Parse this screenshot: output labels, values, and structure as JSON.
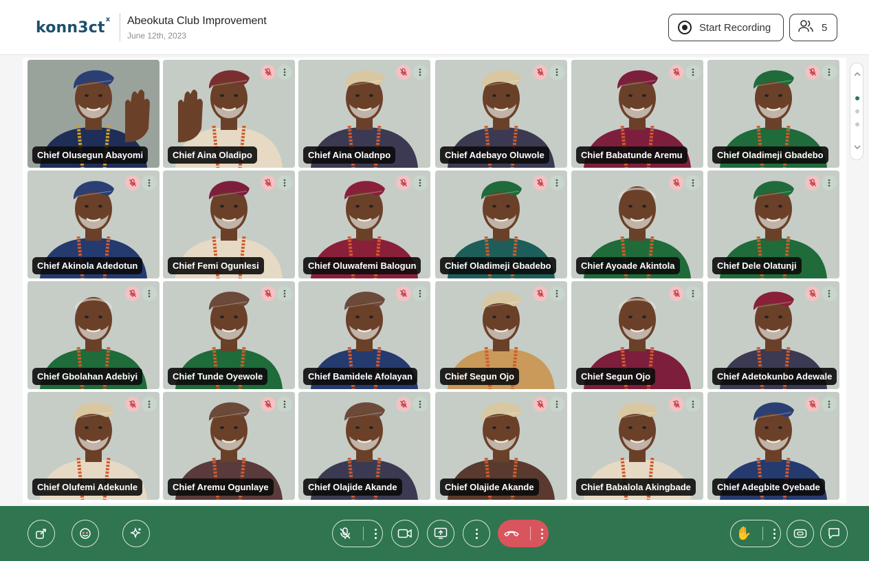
{
  "header": {
    "logo_text": "konn3ct",
    "logo_mark": "x",
    "meeting_title": "Abeokuta Club Improvement",
    "meeting_date": "June 12th, 2023",
    "record_button": "Start Recording",
    "participants_count": "5"
  },
  "participants": [
    {
      "name": "Chief Olusegun Abayomi",
      "cap": "#2b3f74",
      "robe": "#1f2e57",
      "trim": "#d4a017",
      "bg": "#9aa39b",
      "waving": true,
      "muted": false
    },
    {
      "name": "Chief Aina Oladipo",
      "cap": "#7b2e2e",
      "robe": "#e6dac4",
      "trim": "#d45a2a",
      "bg": "#c4ccc5",
      "waving": true,
      "muted": true
    },
    {
      "name": "Chief Aina Oladnpo",
      "cap": "#d8c7a0",
      "robe": "#3b3a52",
      "trim": "#d45a2a",
      "bg": "#c6cdc7",
      "waving": false,
      "muted": true
    },
    {
      "name": "Chief Adebayo Oluwole",
      "cap": "#d8c7a0",
      "robe": "#3b3a52",
      "trim": "#d45a2a",
      "bg": "#c6cdc7",
      "waving": false,
      "muted": true
    },
    {
      "name": "Chief Babatunde Aremu",
      "cap": "#7d1f3c",
      "robe": "#7d1f3c",
      "trim": "#d45a2a",
      "bg": "#c6cdc7",
      "waving": false,
      "muted": true
    },
    {
      "name": "Chief Oladimeji Gbadebo",
      "cap": "#1f6b3a",
      "robe": "#1f6b3a",
      "trim": "#d45a2a",
      "bg": "#c6cdc7",
      "waving": false,
      "muted": true
    },
    {
      "name": "Chief Akinola Adedotun",
      "cap": "#2b3f74",
      "robe": "#253a6e",
      "trim": "#d45a2a",
      "bg": "#c6cdc7",
      "waving": false,
      "muted": true
    },
    {
      "name": "Chief Femi Ogunlesi",
      "cap": "#7d1f3c",
      "robe": "#e6dac4",
      "trim": "#d45a2a",
      "bg": "#c6cdc7",
      "waving": false,
      "muted": true
    },
    {
      "name": "Chief Oluwafemi Balogun",
      "cap": "#8a1f3a",
      "robe": "#8a1f3a",
      "trim": "#d45a2a",
      "bg": "#c6cdc7",
      "waving": false,
      "muted": true
    },
    {
      "name": "Chief Oladimeji Gbadebo",
      "cap": "#1f6b3a",
      "robe": "#1d5e5a",
      "trim": "#d45a2a",
      "bg": "#c6cdc7",
      "waving": false,
      "muted": true
    },
    {
      "name": "Chief Ayoade Akintola",
      "cap": "none",
      "robe": "#1f6b3a",
      "trim": "#d45a2a",
      "bg": "#c6cdc7",
      "waving": false,
      "muted": true
    },
    {
      "name": "Chief Dele Olatunji",
      "cap": "#1f6b3a",
      "robe": "#1f6b3a",
      "trim": "#d45a2a",
      "bg": "#c6cdc7",
      "waving": false,
      "muted": true
    },
    {
      "name": "Chief Gbolahan Adebiyi",
      "cap": "none",
      "robe": "#1f6b3a",
      "trim": "#d45a2a",
      "bg": "#c6cdc7",
      "waving": false,
      "muted": true
    },
    {
      "name": "Chief Tunde Oyewole",
      "cap": "#6b4a3a",
      "robe": "#1f6b3a",
      "trim": "#d45a2a",
      "bg": "#c6cdc7",
      "waving": false,
      "muted": true
    },
    {
      "name": "Chief Bamidele Afolayan",
      "cap": "#6b4a3a",
      "robe": "#253a6e",
      "trim": "#d45a2a",
      "bg": "#c6cdc7",
      "waving": false,
      "muted": true
    },
    {
      "name": "Chief Segun Ojo",
      "cap": "#d8c7a0",
      "robe": "#c99a5a",
      "trim": "#d45a2a",
      "bg": "#c6cdc7",
      "waving": false,
      "muted": true
    },
    {
      "name": "Chief Segun Ojo",
      "cap": "none",
      "robe": "#7d1f3c",
      "trim": "#d45a2a",
      "bg": "#c6cdc7",
      "waving": false,
      "muted": true
    },
    {
      "name": "Chief Adetokunbo Adewale",
      "cap": "#8a1f3a",
      "robe": "#3b3a52",
      "trim": "#d45a2a",
      "bg": "#c6cdc7",
      "waving": false,
      "muted": true
    },
    {
      "name": "Chief Olufemi Adekunle",
      "cap": "#d8c7a0",
      "robe": "#e6dac4",
      "trim": "#d45a2a",
      "bg": "#c6cdc7",
      "waving": false,
      "muted": true
    },
    {
      "name": "Chief Aremu Ogunlaye",
      "cap": "#6b4a3a",
      "robe": "#5a3a3a",
      "trim": "#d45a2a",
      "bg": "#c6cdc7",
      "waving": false,
      "muted": true
    },
    {
      "name": "Chief Olajide Akande",
      "cap": "#6b4a3a",
      "robe": "#3b3a52",
      "trim": "#d45a2a",
      "bg": "#c6cdc7",
      "waving": false,
      "muted": true
    },
    {
      "name": "Chief Olajide Akande",
      "cap": "#d8c7a0",
      "robe": "#5a3a2e",
      "trim": "#d45a2a",
      "bg": "#c6cdc7",
      "waving": false,
      "muted": true
    },
    {
      "name": "Chief Babalola Akingbade",
      "cap": "#d8c7a0",
      "robe": "#e6dac4",
      "trim": "#d45a2a",
      "bg": "#c6cdc7",
      "waving": false,
      "muted": true
    },
    {
      "name": "Chief Adegbite Oyebade",
      "cap": "#2b3f74",
      "robe": "#253a6e",
      "trim": "#d45a2a",
      "bg": "#c6cdc7",
      "waving": false,
      "muted": true
    }
  ],
  "controls": {
    "left": [
      "share-icon",
      "reactions-icon",
      "effects-icon"
    ],
    "center": [
      "mic-off-icon",
      "camera-icon",
      "screen-share-icon",
      "more-icon",
      "hang-up-icon"
    ],
    "right": [
      "raise-hand-icon",
      "captions-icon",
      "chat-icon"
    ]
  },
  "colors": {
    "accent_green": "#2f7550",
    "mute_red": "#f2c2c4",
    "hangup_red": "#d9555d",
    "brand_blue": "#1d4f6e"
  }
}
